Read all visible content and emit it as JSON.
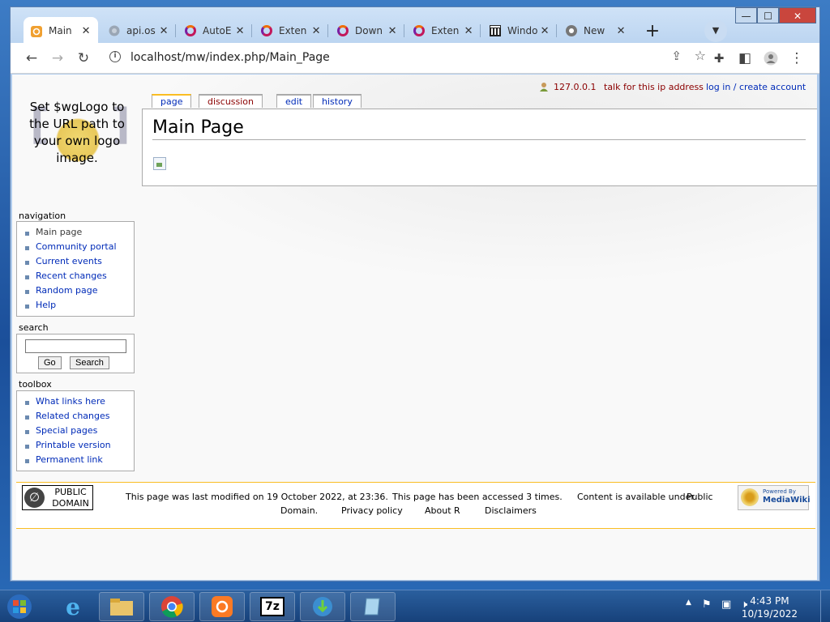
{
  "browser": {
    "tabs": [
      {
        "label": "Main",
        "icon": "mediawiki-icon",
        "active": true
      },
      {
        "label": "api.os",
        "icon": "globe-icon"
      },
      {
        "label": "AutoE",
        "icon": "ring-icon"
      },
      {
        "label": "Exten",
        "icon": "ring-icon"
      },
      {
        "label": "Down",
        "icon": "ring-icon"
      },
      {
        "label": "Exten",
        "icon": "ring-icon"
      },
      {
        "label": "Windo",
        "icon": "library-icon"
      },
      {
        "label": "New",
        "icon": "chrome-icon"
      }
    ],
    "new_tab": "+",
    "close_glyph": "✕",
    "url": "localhost/mw/index.php/Main_Page",
    "window_controls": {
      "minimize": "—",
      "maximize": "☐",
      "close": "✕"
    }
  },
  "page": {
    "personal": {
      "ip": "127.0.0.1",
      "talk": "talk for this ip address",
      "login": "log in / create account"
    },
    "logo_text": "Set $wgLogo to the URL path to your own logo image.",
    "tabs": {
      "page": "page",
      "discussion": "discussion",
      "edit": "edit",
      "history": "history"
    },
    "title": "Main Page",
    "navigation": {
      "heading": "navigation",
      "items": [
        "Main page",
        "Community portal",
        "Current events",
        "Recent changes",
        "Random page",
        "Help"
      ]
    },
    "search": {
      "heading": "search",
      "go": "Go",
      "search": "Search",
      "value": ""
    },
    "toolbox": {
      "heading": "toolbox",
      "items": [
        "What links here",
        "Related changes",
        "Special pages",
        "Printable version",
        "Permanent link"
      ]
    },
    "footer": {
      "pd_line1": "PUBLIC",
      "pd_line2": "DOMAIN",
      "modified": "This page was last modified on 19 October 2022, at 23:36.",
      "accessed": "This page has been accessed 3 times.",
      "content_prefix": "Content is available under",
      "content_link_a": "Public",
      "content_link_b": "Domain.",
      "privacy": "Privacy policy",
      "about": "About R",
      "disclaimers": "Disclaimers",
      "mw_small": "Powered By",
      "mw_big": "MediaWiki"
    }
  },
  "taskbar": {
    "time": "4:43 PM",
    "date": "10/19/2022"
  },
  "colors": {
    "link": "#002bb8",
    "new_link": "#8b0000",
    "accent": "#fabd23"
  }
}
